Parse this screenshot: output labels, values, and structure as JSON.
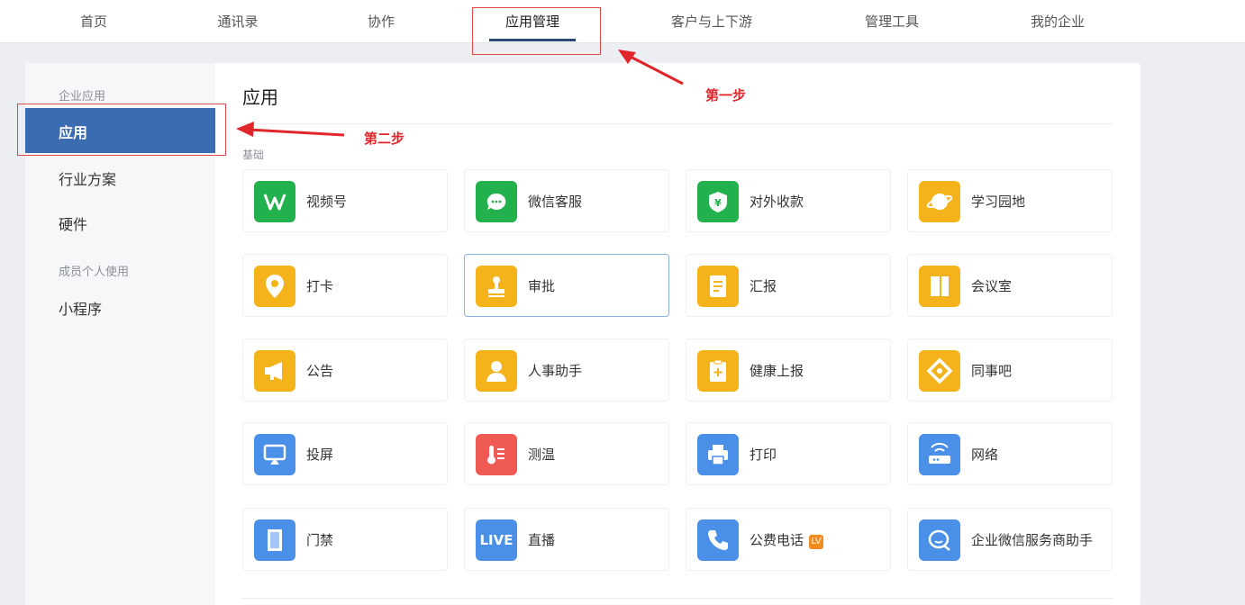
{
  "topnav": {
    "items": [
      "首页",
      "通讯录",
      "协作",
      "应用管理",
      "客户与上下游",
      "管理工具",
      "我的企业"
    ],
    "active_index": 3
  },
  "annotations": {
    "step1": "第一步",
    "step2": "第二步"
  },
  "sidebar": {
    "group1": "企业应用",
    "active_item": "应用",
    "items": [
      "行业方案",
      "硬件"
    ],
    "group2": "成员个人使用",
    "items2": [
      "小程序"
    ]
  },
  "main": {
    "title": "应用",
    "section": "基础",
    "apps": [
      {
        "label": "视频号",
        "icon": "video-channel-icon",
        "color": "#22b14c"
      },
      {
        "label": "微信客服",
        "icon": "wechat-service-icon",
        "color": "#22b14c"
      },
      {
        "label": "对外收款",
        "icon": "payment-icon",
        "color": "#22b14c"
      },
      {
        "label": "学习园地",
        "icon": "learning-planet-icon",
        "color": "#f5b31b"
      },
      {
        "label": "打卡",
        "icon": "location-pin-icon",
        "color": "#f5b31b"
      },
      {
        "label": "审批",
        "icon": "stamp-icon",
        "color": "#f5b31b"
      },
      {
        "label": "汇报",
        "icon": "report-doc-icon",
        "color": "#f5b31b"
      },
      {
        "label": "会议室",
        "icon": "door-icon",
        "color": "#f5b31b"
      },
      {
        "label": "公告",
        "icon": "megaphone-icon",
        "color": "#f5b31b"
      },
      {
        "label": "人事助手",
        "icon": "person-icon",
        "color": "#f5b31b"
      },
      {
        "label": "健康上报",
        "icon": "health-report-icon",
        "color": "#f5b31b"
      },
      {
        "label": "同事吧",
        "icon": "colleague-icon",
        "color": "#f5b31b"
      },
      {
        "label": "投屏",
        "icon": "screen-cast-icon",
        "color": "#4a8fe8"
      },
      {
        "label": "测温",
        "icon": "thermometer-icon",
        "color": "#ef5a55"
      },
      {
        "label": "打印",
        "icon": "printer-icon",
        "color": "#4a8fe8"
      },
      {
        "label": "网络",
        "icon": "router-icon",
        "color": "#4a8fe8"
      },
      {
        "label": "门禁",
        "icon": "access-door-icon",
        "color": "#4a8fe8"
      },
      {
        "label": "直播",
        "icon": "live-icon",
        "color": "#4a8fe8",
        "icon_text": "LIVE"
      },
      {
        "label": "公费电话",
        "icon": "phone-icon",
        "color": "#4a8fe8",
        "badge": "LV"
      },
      {
        "label": "企业微信服务商助手",
        "icon": "service-chat-icon",
        "color": "#4a8fe8"
      }
    ],
    "selected_index": 5
  }
}
